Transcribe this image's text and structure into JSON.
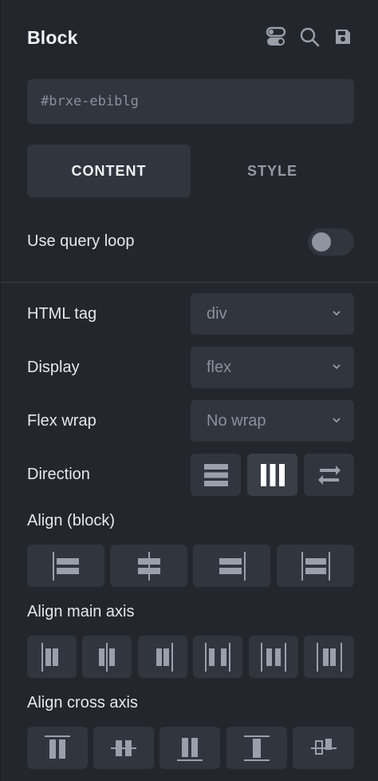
{
  "header": {
    "title": "Block",
    "icons": [
      "toggle-icon",
      "search-icon",
      "save-icon"
    ]
  },
  "id_field": {
    "value": "#brxe-ebiblg"
  },
  "tabs": [
    {
      "label": "CONTENT",
      "active": true
    },
    {
      "label": "STYLE",
      "active": false
    }
  ],
  "query_loop": {
    "label": "Use query loop",
    "enabled": false
  },
  "controls": {
    "html_tag": {
      "label": "HTML tag",
      "value": "div"
    },
    "display": {
      "label": "Display",
      "value": "flex"
    },
    "flex_wrap": {
      "label": "Flex wrap",
      "value": "No wrap"
    },
    "direction": {
      "label": "Direction",
      "options": [
        "column",
        "row",
        "reverse"
      ],
      "selected": "row"
    },
    "align_block": {
      "label": "Align (block)",
      "options": [
        "left",
        "center",
        "right",
        "stretch"
      ]
    },
    "align_main_axis": {
      "label": "Align main axis",
      "options": [
        "flex-start",
        "center",
        "flex-end",
        "space-between",
        "space-around",
        "space-evenly"
      ]
    },
    "align_cross_axis": {
      "label": "Align cross axis",
      "options": [
        "flex-start",
        "center",
        "flex-end",
        "stretch",
        "baseline"
      ]
    }
  },
  "colors": {
    "background": "#23262d",
    "surface": "#31353e",
    "text": "#e6e8ec",
    "muted": "#8b909a"
  }
}
